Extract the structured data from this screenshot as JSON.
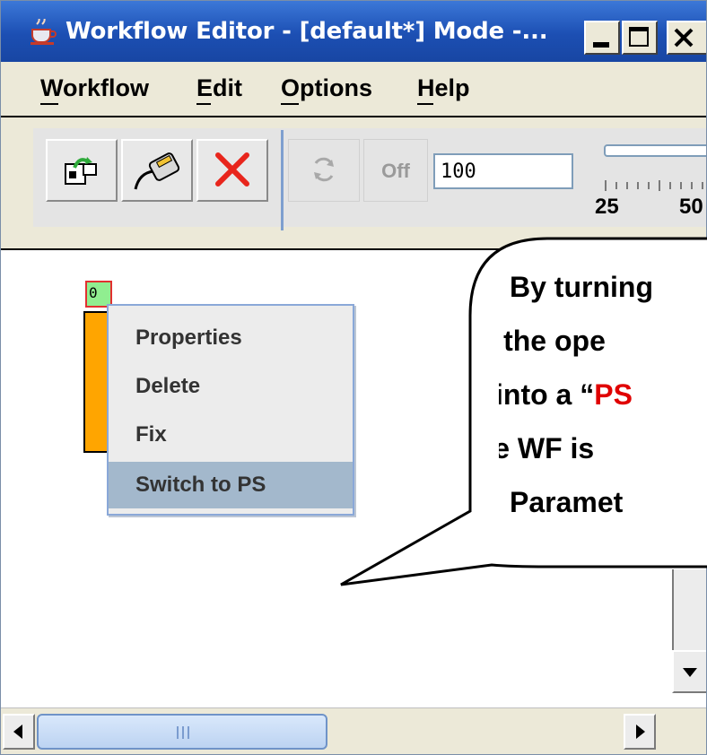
{
  "window": {
    "title": "Workflow Editor - [default*] Mode -..."
  },
  "menubar": {
    "items": [
      {
        "label": "Workflow"
      },
      {
        "label": "Edit"
      },
      {
        "label": "Options"
      },
      {
        "label": "Help"
      }
    ]
  },
  "toolbar": {
    "off_label": "Off",
    "speed_value": "100",
    "slider_labels": [
      "25",
      "50"
    ]
  },
  "canvas": {
    "node_label": "0"
  },
  "context_menu": {
    "items": [
      {
        "label": "Properties"
      },
      {
        "label": "Delete"
      },
      {
        "label": "Fix"
      },
      {
        "label": "Switch to PS"
      }
    ],
    "selected": "Switch to PS"
  },
  "callout": {
    "line1": "By turning",
    "line2": "of the ope",
    "line3_pre": "into a “",
    "line3_red": "PS",
    "line4": "the WF is",
    "line5": "Paramet"
  },
  "colors": {
    "titlebar": "#1c4fb3",
    "node": "#ffa500",
    "node_label_bg": "#90ee90",
    "menu_highlight": "#a3b8cc",
    "callout_accent": "#e00000"
  }
}
